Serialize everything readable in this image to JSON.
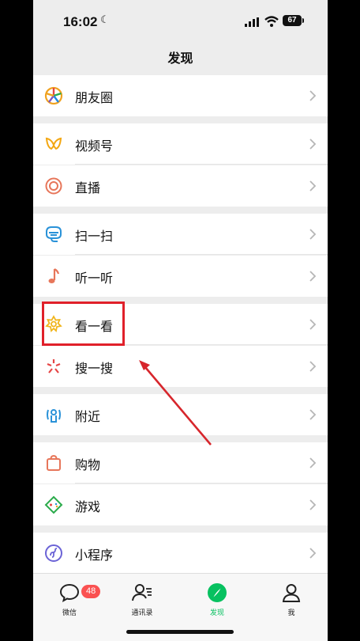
{
  "status": {
    "time": "16:02",
    "battery": "67"
  },
  "page_title": "发现",
  "menu": [
    {
      "label": "朋友圈",
      "icon": "moments-icon"
    },
    {
      "label": "视频号",
      "icon": "channels-icon"
    },
    {
      "label": "直播",
      "icon": "live-icon"
    },
    {
      "label": "扫一扫",
      "icon": "scan-icon"
    },
    {
      "label": "听一听",
      "icon": "listen-icon"
    },
    {
      "label": "看一看",
      "icon": "top-stories-icon"
    },
    {
      "label": "搜一搜",
      "icon": "search-icon"
    },
    {
      "label": "附近",
      "icon": "nearby-icon"
    },
    {
      "label": "购物",
      "icon": "shopping-icon"
    },
    {
      "label": "游戏",
      "icon": "games-icon"
    },
    {
      "label": "小程序",
      "icon": "mini-programs-icon"
    }
  ],
  "tabs": [
    {
      "label": "微信",
      "badge": "48"
    },
    {
      "label": "通讯录"
    },
    {
      "label": "发现"
    },
    {
      "label": "我"
    }
  ],
  "colors": {
    "accent": "#07c160",
    "highlight": "#e0202a",
    "badge": "#fa5151"
  }
}
